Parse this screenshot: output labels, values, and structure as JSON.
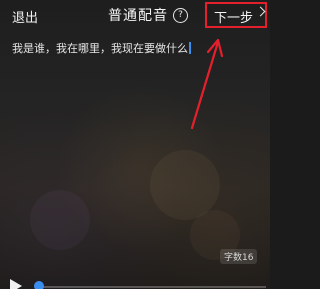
{
  "header": {
    "exit_label": "退出",
    "title": "普通配音",
    "help_icon": "question-circle-icon",
    "next_label": "下一步",
    "next_icon": "chevron-right-icon"
  },
  "editor": {
    "text": "我是谁，我在哪里，我现在要做什么"
  },
  "word_count": {
    "label": "字数16"
  },
  "player": {
    "play_icon": "play-icon",
    "progress": 0.0
  },
  "colors": {
    "highlight": "#e4202c",
    "accent": "#3a8ef0"
  }
}
